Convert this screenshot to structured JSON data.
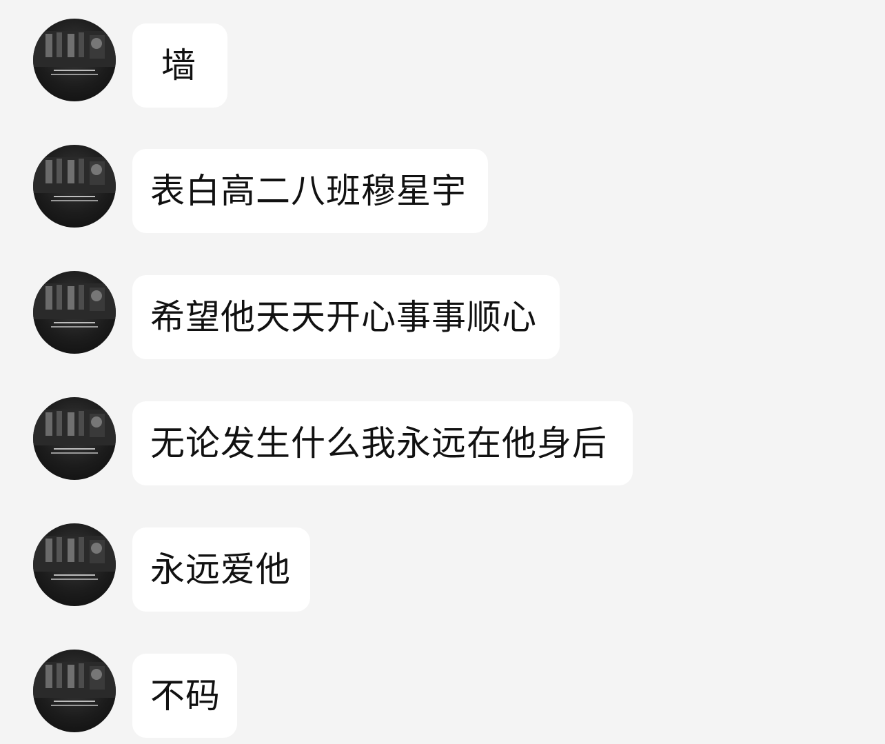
{
  "chat": {
    "messages": [
      {
        "text": "墙",
        "avatar_icon": "dark-photo-avatar-icon"
      },
      {
        "text": "表白高二八班穆星宇",
        "avatar_icon": "dark-photo-avatar-icon"
      },
      {
        "text": "希望他天天开心事事顺心",
        "avatar_icon": "dark-photo-avatar-icon"
      },
      {
        "text": "无论发生什么我永远在他身后",
        "avatar_icon": "dark-photo-avatar-icon"
      },
      {
        "text": "永远爱他",
        "avatar_icon": "dark-photo-avatar-icon"
      },
      {
        "text": "不码",
        "avatar_icon": "dark-photo-avatar-icon"
      }
    ]
  },
  "colors": {
    "background": "#f4f4f4",
    "bubble": "#ffffff",
    "text": "#111111",
    "avatar_dark": "#0c0c0c"
  }
}
